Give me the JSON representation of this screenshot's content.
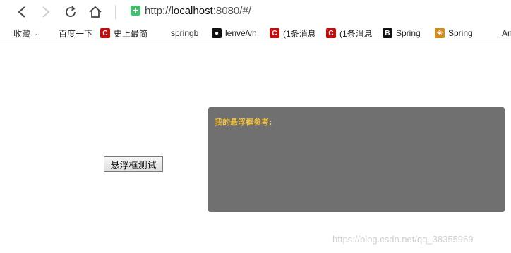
{
  "browser": {
    "url_protocol": "http://",
    "url_host": "localhost",
    "url_rest": ":8080/#/"
  },
  "bookmarks": [
    {
      "label": "收藏",
      "icon": "star-icon"
    },
    {
      "label": "百度一下",
      "icon": "baidu-paw-icon"
    },
    {
      "label": "史上最简",
      "icon": "csdn-icon"
    },
    {
      "label": "springb",
      "icon": "springboot-icon"
    },
    {
      "label": "lenve/vh",
      "icon": "github-icon"
    },
    {
      "label": "(1条消息",
      "icon": "csdn-icon"
    },
    {
      "label": "(1条消息",
      "icon": "csdn-icon"
    },
    {
      "label": "Spring",
      "icon": "b-icon"
    },
    {
      "label": "Spring",
      "icon": "spring-icon"
    },
    {
      "label": "An",
      "icon": "ant-design-icon"
    }
  ],
  "page": {
    "button_label": "悬浮框测试",
    "panel_title": "我的悬浮框参考:",
    "watermark": "https://blog.csdn.net/qq_38355969"
  },
  "colors": {
    "panel_bg": "#707070",
    "panel_title": "#f0c040"
  }
}
